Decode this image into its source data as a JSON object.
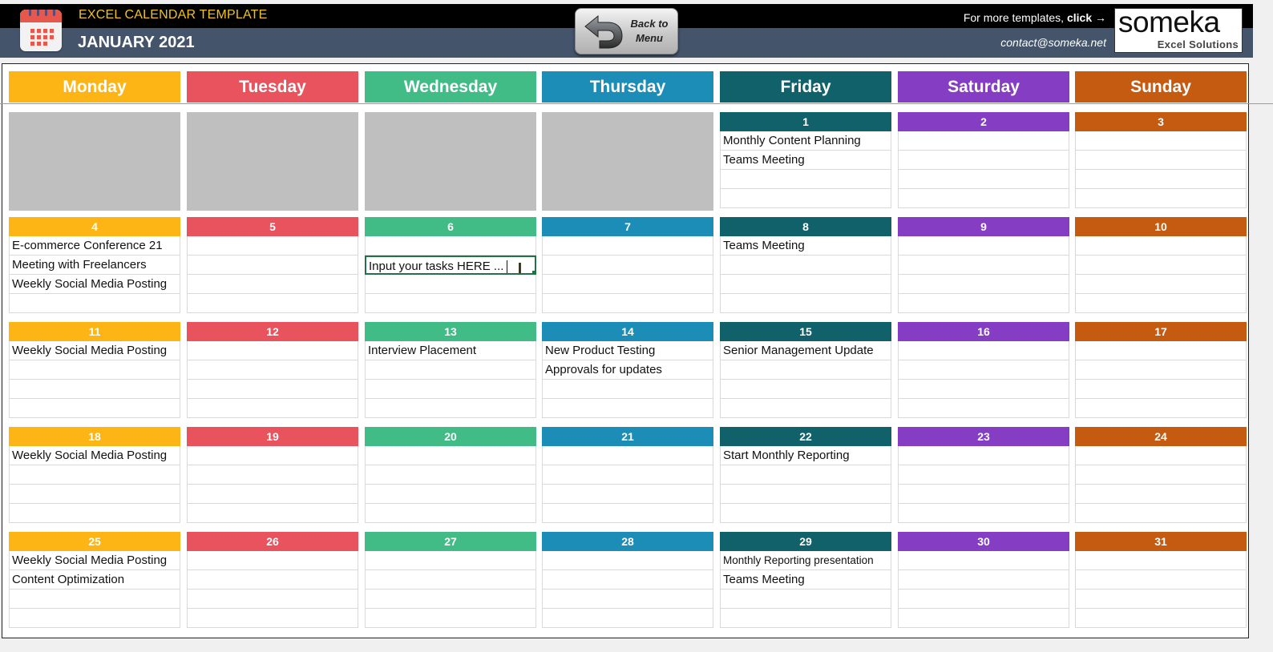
{
  "header": {
    "app_title": "EXCEL CALENDAR TEMPLATE",
    "month_title": "JANUARY 2021",
    "back_button": {
      "line1": "Back to",
      "line2": "Menu"
    },
    "more_templates_text": "For more templates,",
    "more_templates_link": "click →",
    "contact_email": "contact@someka.net",
    "logo": {
      "brand": "someka",
      "tagline": "Excel Solutions"
    }
  },
  "colors": {
    "Monday": "#fdb515",
    "Tuesday": "#e9535e",
    "Wednesday": "#42bc86",
    "Thursday": "#1b8db7",
    "Friday": "#11616b",
    "Saturday": "#853dc4",
    "Sunday": "#c55a11",
    "blank": "#bfbfbf",
    "header_black": "#000000",
    "header_slate": "#44546a",
    "title_gold": "#f2c21b"
  },
  "weekdays": [
    "Monday",
    "Tuesday",
    "Wednesday",
    "Thursday",
    "Friday",
    "Saturday",
    "Sunday"
  ],
  "leading_blank_days": 4,
  "active_cell": {
    "day": 6,
    "row": 2,
    "value": "Input your tasks HERE ..."
  },
  "days": [
    {
      "day": 1,
      "tasks": [
        "Monthly Content Planning",
        "Teams Meeting",
        "",
        ""
      ]
    },
    {
      "day": 2,
      "tasks": [
        "",
        "",
        "",
        ""
      ]
    },
    {
      "day": 3,
      "tasks": [
        "",
        "",
        "",
        ""
      ]
    },
    {
      "day": 4,
      "tasks": [
        "E-commerce Conference 21",
        "Meeting with Freelancers",
        "Weekly Social Media Posting",
        ""
      ]
    },
    {
      "day": 5,
      "tasks": [
        "",
        "",
        "",
        ""
      ]
    },
    {
      "day": 6,
      "tasks": [
        "",
        "Input your tasks HERE ...",
        "",
        ""
      ]
    },
    {
      "day": 7,
      "tasks": [
        "",
        "",
        "",
        ""
      ]
    },
    {
      "day": 8,
      "tasks": [
        "Teams Meeting",
        "",
        "",
        ""
      ]
    },
    {
      "day": 9,
      "tasks": [
        "",
        "",
        "",
        ""
      ]
    },
    {
      "day": 10,
      "tasks": [
        "",
        "",
        "",
        ""
      ]
    },
    {
      "day": 11,
      "tasks": [
        "Weekly Social Media Posting",
        "",
        "",
        ""
      ]
    },
    {
      "day": 12,
      "tasks": [
        "",
        "",
        "",
        ""
      ]
    },
    {
      "day": 13,
      "tasks": [
        "Interview Placement",
        "",
        "",
        ""
      ]
    },
    {
      "day": 14,
      "tasks": [
        "New Product Testing",
        "Approvals for updates",
        "",
        ""
      ]
    },
    {
      "day": 15,
      "tasks": [
        "Senior Management Update",
        "",
        "",
        ""
      ]
    },
    {
      "day": 16,
      "tasks": [
        "",
        "",
        "",
        ""
      ]
    },
    {
      "day": 17,
      "tasks": [
        "",
        "",
        "",
        ""
      ]
    },
    {
      "day": 18,
      "tasks": [
        "Weekly Social Media Posting",
        "",
        "",
        ""
      ]
    },
    {
      "day": 19,
      "tasks": [
        "",
        "",
        "",
        ""
      ]
    },
    {
      "day": 20,
      "tasks": [
        "",
        "",
        "",
        ""
      ]
    },
    {
      "day": 21,
      "tasks": [
        "",
        "",
        "",
        ""
      ]
    },
    {
      "day": 22,
      "tasks": [
        "Start Monthly Reporting",
        "",
        "",
        ""
      ]
    },
    {
      "day": 23,
      "tasks": [
        "",
        "",
        "",
        ""
      ]
    },
    {
      "day": 24,
      "tasks": [
        "",
        "",
        "",
        ""
      ]
    },
    {
      "day": 25,
      "tasks": [
        "Weekly Social Media Posting",
        "Content Optimization",
        "",
        ""
      ]
    },
    {
      "day": 26,
      "tasks": [
        "",
        "",
        "",
        ""
      ]
    },
    {
      "day": 27,
      "tasks": [
        "",
        "",
        "",
        ""
      ]
    },
    {
      "day": 28,
      "tasks": [
        "",
        "",
        "",
        ""
      ]
    },
    {
      "day": 29,
      "tasks": [
        "Monthly Reporting presentation",
        "Teams Meeting",
        "",
        ""
      ]
    },
    {
      "day": 30,
      "tasks": [
        "",
        "",
        "",
        ""
      ]
    },
    {
      "day": 31,
      "tasks": [
        "",
        "",
        "",
        ""
      ]
    }
  ]
}
